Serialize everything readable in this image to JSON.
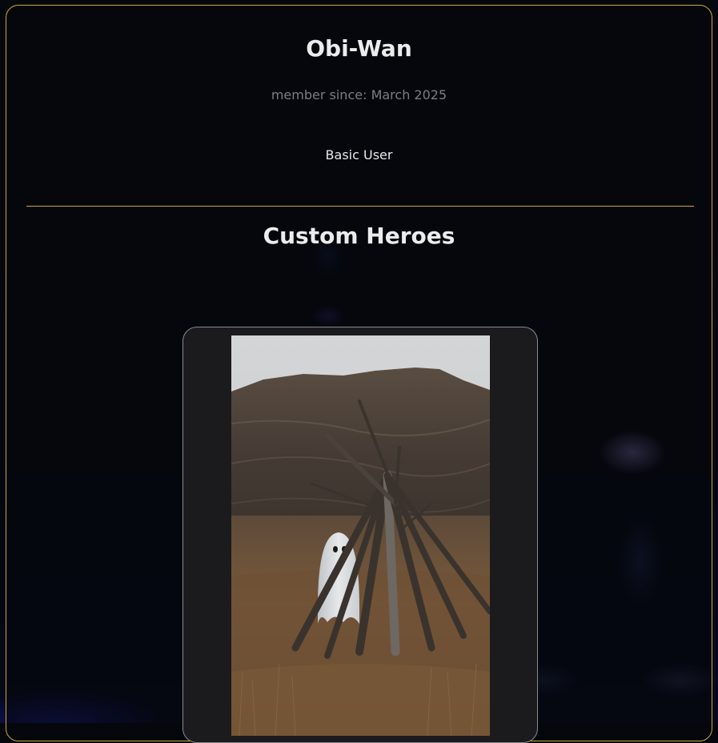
{
  "profile": {
    "username": "Obi-Wan",
    "member_since": "member since: March 2025",
    "role": "Basic User"
  },
  "heroes_section": {
    "title": "Custom Heroes",
    "heroes": [
      {
        "image_subject": "ghost-in-field-photo"
      }
    ]
  },
  "colors": {
    "accent": "#c9a93a",
    "background": "#05070c",
    "card_background": "#1b1b1d",
    "text_primary": "#ececec",
    "text_muted": "#7b7d82"
  }
}
